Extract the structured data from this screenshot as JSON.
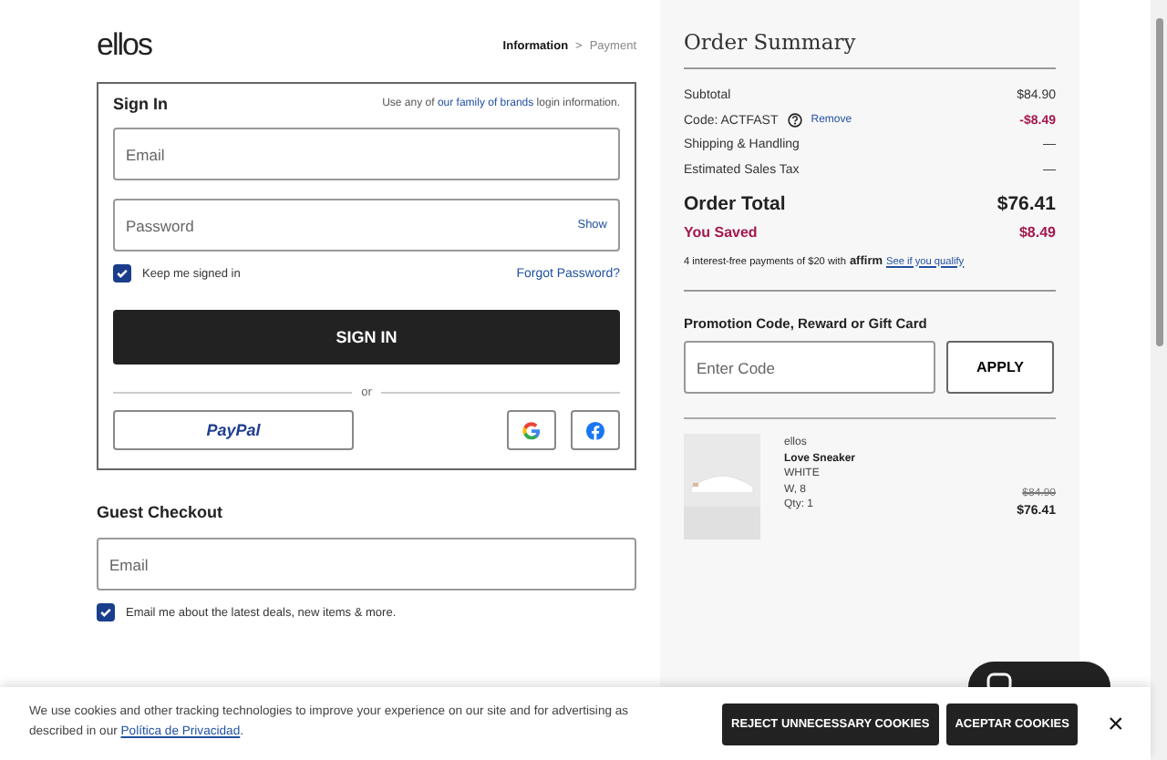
{
  "header": {
    "logo": "ellos",
    "breadcrumb": [
      {
        "label": "Information",
        "selected": true
      },
      {
        "label": "Payment",
        "selected": false
      }
    ],
    "separator": ">"
  },
  "sign_in": {
    "title": "Sign In",
    "note_before": "Use any of",
    "note_link": "our family of brands",
    "note_after": "login information.",
    "email_placeholder": "Email",
    "password_placeholder": "Password",
    "show": "Show",
    "keep_signed_in": {
      "label": "Keep me signed in",
      "checked": true
    },
    "forgot": "Forgot Password?",
    "button": "SIGN IN",
    "or": "or",
    "paypal": "PayPal"
  },
  "guest": {
    "title": "Guest Checkout",
    "email_placeholder": "Email",
    "opt_in": {
      "label": "Email me about the latest deals, new items & more.",
      "checked": true
    }
  },
  "summary": {
    "title": "Order Summary",
    "lines": [
      {
        "label": "Subtotal",
        "value": "$84.90",
        "kind": "plain"
      },
      {
        "label": "Code: ACTFAST",
        "link": "Remove",
        "value": "-$8.49",
        "kind": "discount"
      },
      {
        "label": "Shipping & Handling",
        "value": "—",
        "kind": "plain"
      },
      {
        "label": "Estimated Sales Tax",
        "value": "—",
        "kind": "plain"
      }
    ],
    "total_label": "Order Total",
    "total": "$76.41",
    "saved_label": "You Saved",
    "saved": "$8.49",
    "affirm_text": "4 interest-free payments of $20 with",
    "affirm_logo": "affirm",
    "affirm_link": "See if you qualify",
    "promo_title": "Promotion Code, Reward or Gift Card",
    "promo_placeholder": "Enter Code",
    "apply": "APPLY",
    "item": {
      "brand": "ellos",
      "name": "Love Sneaker",
      "variant": "WHITE",
      "size": "W, 8",
      "qty": "Qty: 1",
      "old_price": "$84.90",
      "price": "$76.41"
    }
  },
  "cookies": {
    "text": "We use cookies and other tracking technologies to improve your experience on our site and for advertising as described in our",
    "link": "Política de Privacidad",
    "end": ".",
    "reject": "REJECT UNNECESSARY COOKIES",
    "accept": "ACEPTAR COOKIES",
    "close": "×"
  }
}
